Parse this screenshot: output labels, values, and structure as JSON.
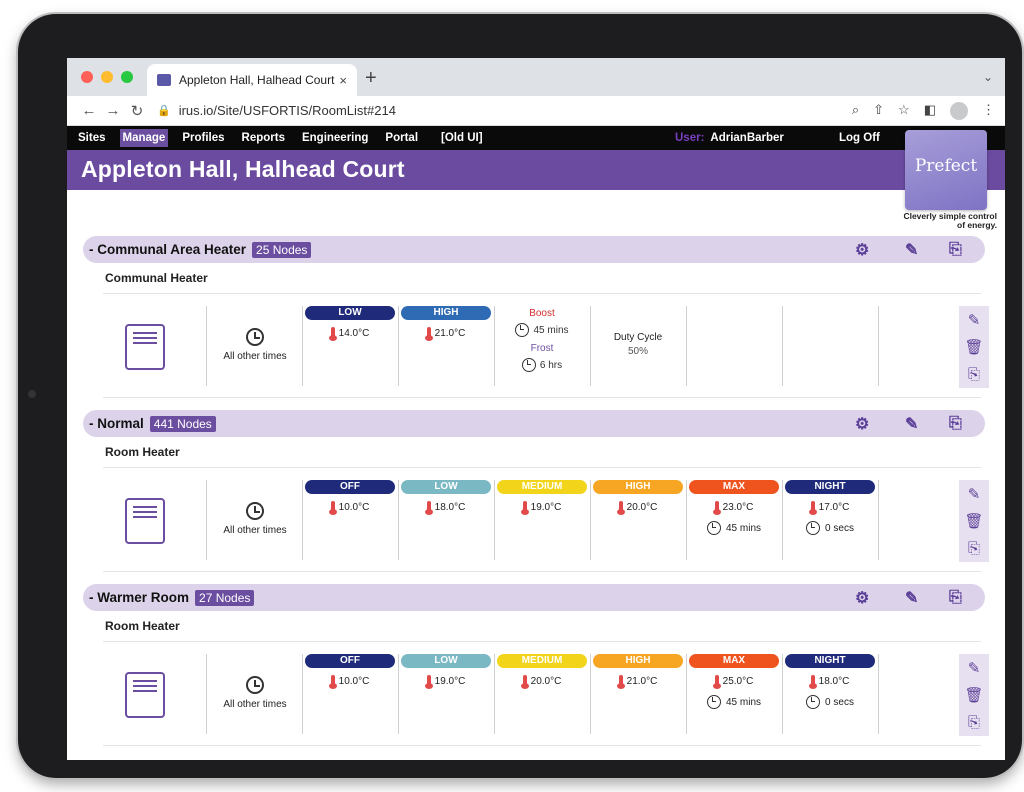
{
  "browser": {
    "tab_title": "Appleton Hall, Halhead Court",
    "tab_close": "×",
    "new_tab": "+",
    "url": "irus.io/Site/USFORTIS/RoomList#214"
  },
  "nav": {
    "items": [
      "Sites",
      "Manage",
      "Profiles",
      "Reports",
      "Engineering",
      "Portal",
      "[Old UI]"
    ],
    "active": "Manage",
    "user_label": "User:",
    "user_name": "AdrianBarber",
    "logoff": "Log Off"
  },
  "page_title": "Appleton Hall, Halhead Court",
  "logo": {
    "text": "Prefect",
    "tagline": "Cleverly simple control of energy."
  },
  "colors": {
    "accent": "#6b4ea0",
    "light_accent": "#dcd3ea",
    "nav_bg": "#0a0a0a"
  },
  "groups": [
    {
      "name": "- Communal Area Heater",
      "count": "25 Nodes",
      "device": "Communal Heater",
      "schedule": "All other times",
      "modes": [
        {
          "label": "LOW",
          "temp": "14.0°C",
          "color": "#1f2a7a"
        },
        {
          "label": "HIGH",
          "temp": "21.0°C",
          "color": "#2f6bb5"
        }
      ],
      "boost": {
        "label": "Boost",
        "boost_duration": "45 mins",
        "frost_label": "Frost",
        "frost_duration": "6 hrs"
      },
      "duty": {
        "label": "Duty Cycle",
        "value": "50%"
      }
    },
    {
      "name": "- Normal",
      "count": "441 Nodes",
      "device": "Room Heater",
      "schedule": "All other times",
      "modes": [
        {
          "label": "OFF",
          "temp": "10.0°C",
          "color": "#1f2a7a"
        },
        {
          "label": "LOW",
          "temp": "18.0°C",
          "color": "#7ab8c4"
        },
        {
          "label": "MEDIUM",
          "temp": "19.0°C",
          "color": "#f2d51a"
        },
        {
          "label": "HIGH",
          "temp": "20.0°C",
          "color": "#f6a623"
        },
        {
          "label": "MAX",
          "temp": "23.0°C",
          "color": "#f0541e",
          "duration": "45 mins"
        },
        {
          "label": "NIGHT",
          "temp": "17.0°C",
          "color": "#1f2a7a",
          "duration": "0 secs"
        }
      ]
    },
    {
      "name": "- Warmer Room",
      "count": "27 Nodes",
      "device": "Room Heater",
      "schedule": "All other times",
      "modes": [
        {
          "label": "OFF",
          "temp": "10.0°C",
          "color": "#1f2a7a"
        },
        {
          "label": "LOW",
          "temp": "19.0°C",
          "color": "#7ab8c4"
        },
        {
          "label": "MEDIUM",
          "temp": "20.0°C",
          "color": "#f2d51a"
        },
        {
          "label": "HIGH",
          "temp": "21.0°C",
          "color": "#f6a623"
        },
        {
          "label": "MAX",
          "temp": "25.0°C",
          "color": "#f0541e",
          "duration": "45 mins"
        },
        {
          "label": "NIGHT",
          "temp": "18.0°C",
          "color": "#1f2a7a",
          "duration": "0 secs"
        }
      ]
    }
  ]
}
